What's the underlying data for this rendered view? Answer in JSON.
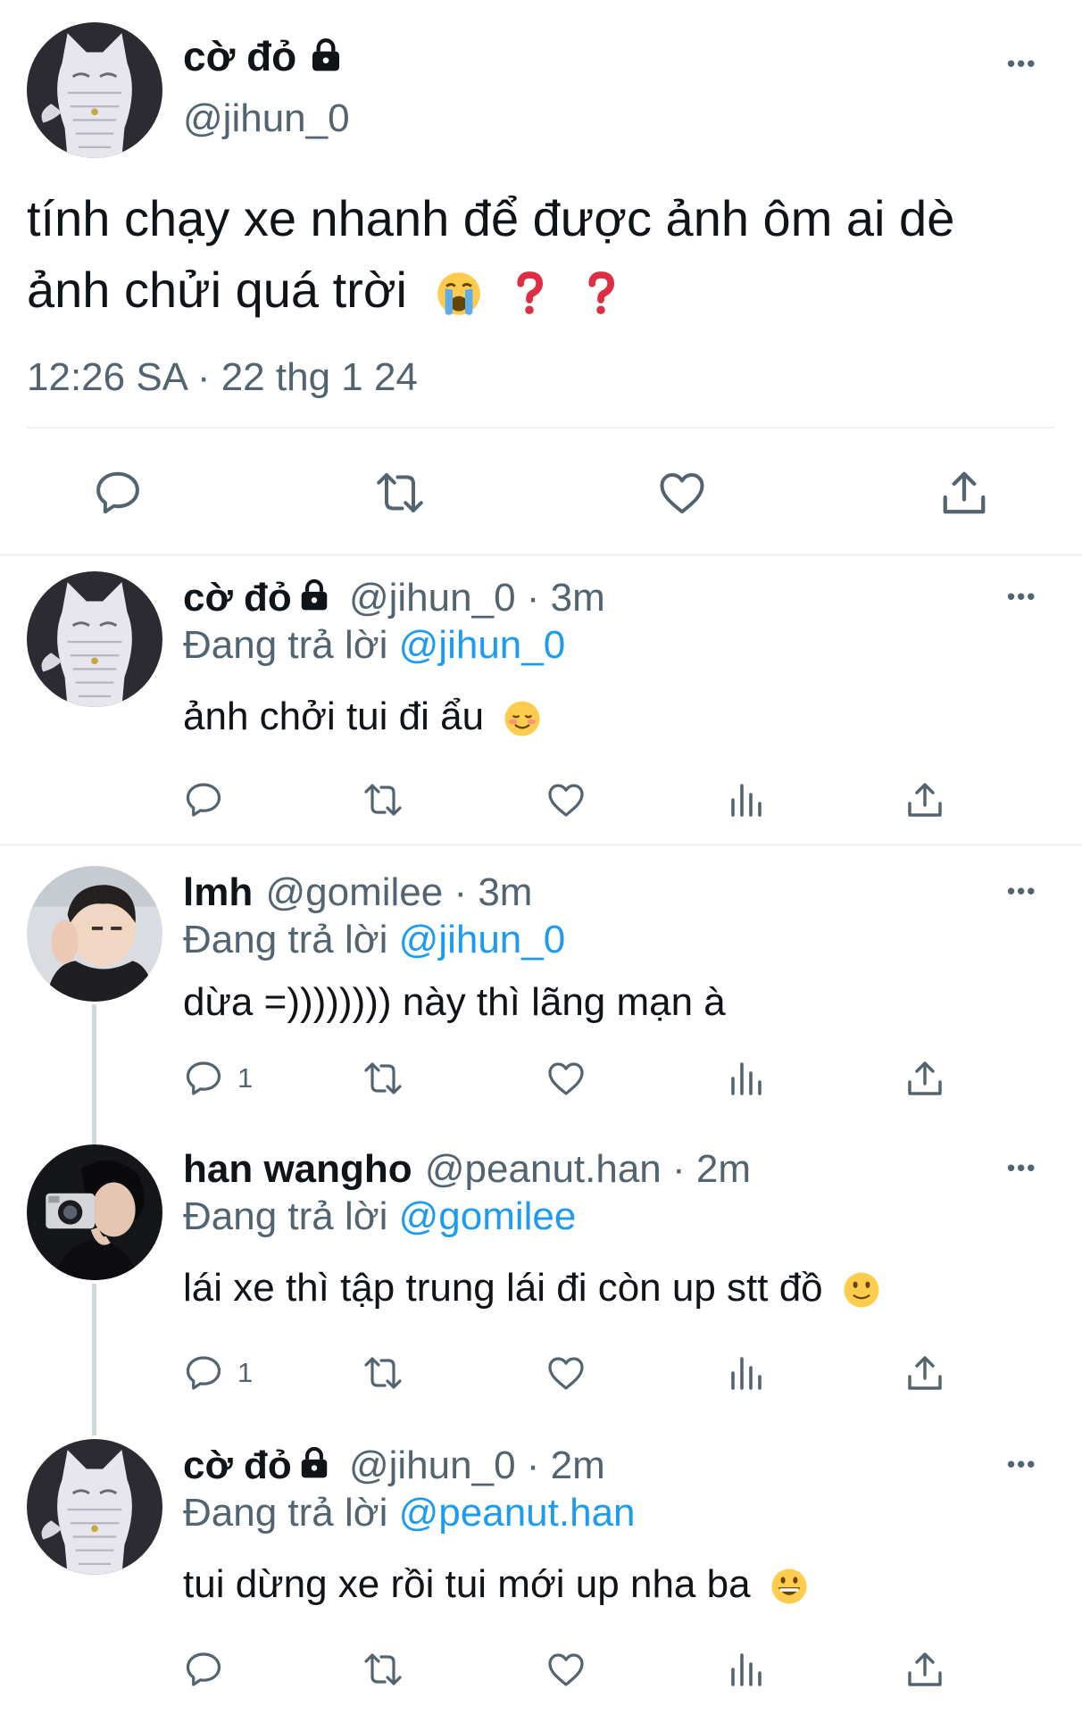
{
  "main_tweet": {
    "display_name": "cờ đỏ",
    "handle": "@jihun_0",
    "text_line1": "tính chạy xe nhanh để được ảnh ôm ai dè",
    "text_line2": "ảnh chửi quá trời",
    "timestamp": "12:26 SA · 22 thg 1 24",
    "emojis": [
      "loudly-crying-face",
      "red-question-mark",
      "red-question-mark"
    ]
  },
  "replies": [
    {
      "display_name": "cờ đỏ",
      "meta": "@jihun_0 · 3m",
      "replying_prefix": "Đang trả lời",
      "replying_to": "@jihun_0",
      "text": "ảnh chởi tui đi ẩu",
      "emoji": "smiling-face",
      "reply_count": "",
      "locked": true
    },
    {
      "display_name": "lmh",
      "meta": "@gomilee · 3m",
      "replying_prefix": "Đang trả lời",
      "replying_to": "@jihun_0",
      "text": "dừa =)))))))) này thì lãng mạn à",
      "emoji": "",
      "reply_count": "1",
      "locked": false
    },
    {
      "display_name": "han wangho",
      "meta": "@peanut.han · 2m",
      "replying_prefix": "Đang trả lời",
      "replying_to": "@gomilee",
      "text": "lái xe thì tập trung lái đi còn up stt đồ",
      "emoji": "slightly-smiling-face",
      "reply_count": "1",
      "locked": false
    },
    {
      "display_name": "cờ đỏ",
      "meta": "@jihun_0 · 2m",
      "replying_prefix": "Đang trả lời",
      "replying_to": "@peanut.han",
      "text": "tui dừng xe rồi tui mới up nha ba",
      "emoji": "grinning-face",
      "reply_count": "",
      "locked": true
    }
  ],
  "icons": {
    "more": "more-horizontal-icon",
    "reply": "reply-bubble-icon",
    "retweet": "retweet-icon",
    "like": "heart-icon",
    "views": "views-bar-icon",
    "share": "share-upload-icon",
    "lock": "lock-icon"
  },
  "colors": {
    "text": "#0f1419",
    "secondary": "#536471",
    "link": "#1d9bf0",
    "divider": "#eff3f4"
  },
  "more_glyph": "•••"
}
